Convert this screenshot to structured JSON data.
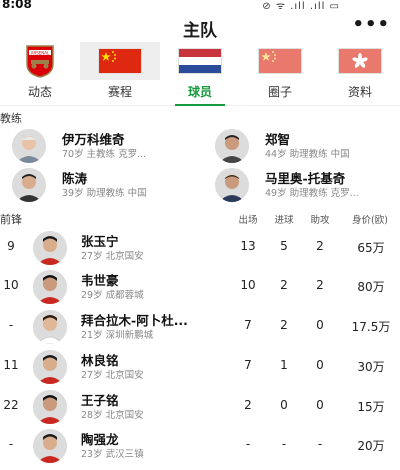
{
  "status": {
    "time": "8:08",
    "signal": "⊘ ᯤ .ıll .ıll ▭"
  },
  "header": {
    "title": "主队",
    "more_label": "•••"
  },
  "team_bar": [
    {
      "name": "Arsenal",
      "selected": false
    },
    {
      "name": "中国",
      "selected": true
    },
    {
      "name": "荷兰",
      "selected": false
    },
    {
      "name": "中国",
      "selected": false
    },
    {
      "name": "香港",
      "selected": false
    }
  ],
  "tabs": [
    {
      "label": "动态",
      "active": false
    },
    {
      "label": "赛程",
      "active": false
    },
    {
      "label": "球员",
      "active": true
    },
    {
      "label": "圈子",
      "active": false
    },
    {
      "label": "资料",
      "active": false
    }
  ],
  "coaches_section": "教练",
  "coaches": [
    {
      "name": "伊万科维奇",
      "info": "70岁 主教练 克罗..."
    },
    {
      "name": "郑智",
      "info": "44岁 助理教练 中国"
    },
    {
      "name": "陈涛",
      "info": "39岁 助理教练 中国"
    },
    {
      "name": "马里奥-托基奇",
      "info": "49岁 助理教练 克罗..."
    }
  ],
  "forwards_section": "前锋",
  "columns": {
    "apps": "出场",
    "goals": "进球",
    "assists": "助攻",
    "value": "身价(欧)"
  },
  "players": [
    {
      "number": "9",
      "name": "张玉宁",
      "info": "27岁 北京国安",
      "apps": "13",
      "goals": "5",
      "assists": "2",
      "value": "65万"
    },
    {
      "number": "10",
      "name": "韦世豪",
      "info": "29岁 成都蓉城",
      "apps": "10",
      "goals": "2",
      "assists": "2",
      "value": "80万"
    },
    {
      "number": "-",
      "name": "拜合拉木-阿卜杜...",
      "info": "21岁 深圳新鹏城",
      "apps": "7",
      "goals": "2",
      "assists": "0",
      "value": "17.5万"
    },
    {
      "number": "11",
      "name": "林良铭",
      "info": "27岁 北京国安",
      "apps": "7",
      "goals": "1",
      "assists": "0",
      "value": "30万"
    },
    {
      "number": "22",
      "name": "王子铭",
      "info": "28岁 北京国安",
      "apps": "2",
      "goals": "0",
      "assists": "0",
      "value": "15万"
    },
    {
      "number": "-",
      "name": "陶强龙",
      "info": "23岁 武汉三镇",
      "apps": "-",
      "goals": "-",
      "assists": "-",
      "value": "20万"
    }
  ],
  "colors": {
    "accent": "#1a9a3f",
    "china_red": "#de2910",
    "star_yellow": "#ffde00"
  }
}
